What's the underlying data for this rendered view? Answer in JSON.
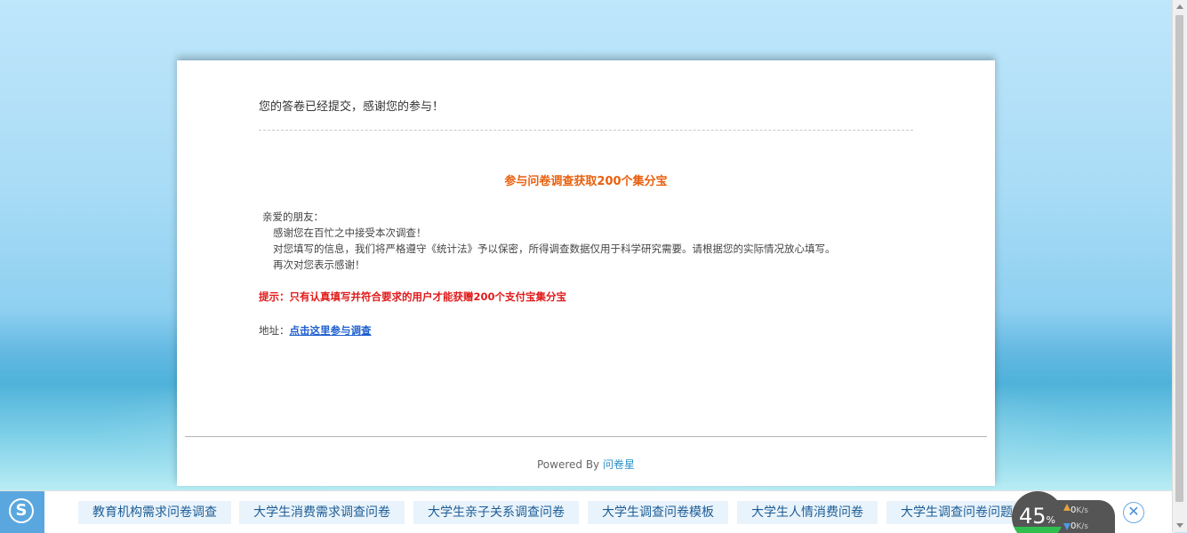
{
  "survey": {
    "submitted_message": "您的答卷已经提交，感谢您的参与！",
    "promo_title": "参与问卷调查获取200个集分宝",
    "letter": {
      "greeting": "亲爱的朋友：",
      "line1": "感谢您在百忙之中接受本次调查！",
      "line2": "对您填写的信息，我们将严格遵守《统计法》予以保密，所得调查数据仅用于科学研究需要。请根据您的实际情况放心填写。",
      "line3": "再次对您表示感谢！"
    },
    "tip": "提示：只有认真填写并符合要求的用户才能获赠200个支付宝集分宝",
    "address_label": "地址：",
    "address_link": "点击这里参与调查",
    "powered_by": "Powered By",
    "brand": "问卷星"
  },
  "bottom_bar": {
    "logo_icon": "sogou-s-icon",
    "logo_letter": "S",
    "items": [
      "教育机构需求问卷调查",
      "大学生消费需求调查问卷",
      "大学生亲子关系调查问卷",
      "大学生调查问卷模板",
      "大学生人情消费问卷",
      "大学生调查问卷问题"
    ],
    "speed_widget": {
      "percent": "45",
      "percent_unit": "%",
      "upload": "0",
      "download": "0",
      "unit": "K/s"
    },
    "close_symbol": "✕"
  },
  "colors": {
    "promo_orange": "#e8600e",
    "tip_red": "#e01b1b",
    "link_blue": "#1f5fcf",
    "chip_bg": "#e9f3fb"
  }
}
